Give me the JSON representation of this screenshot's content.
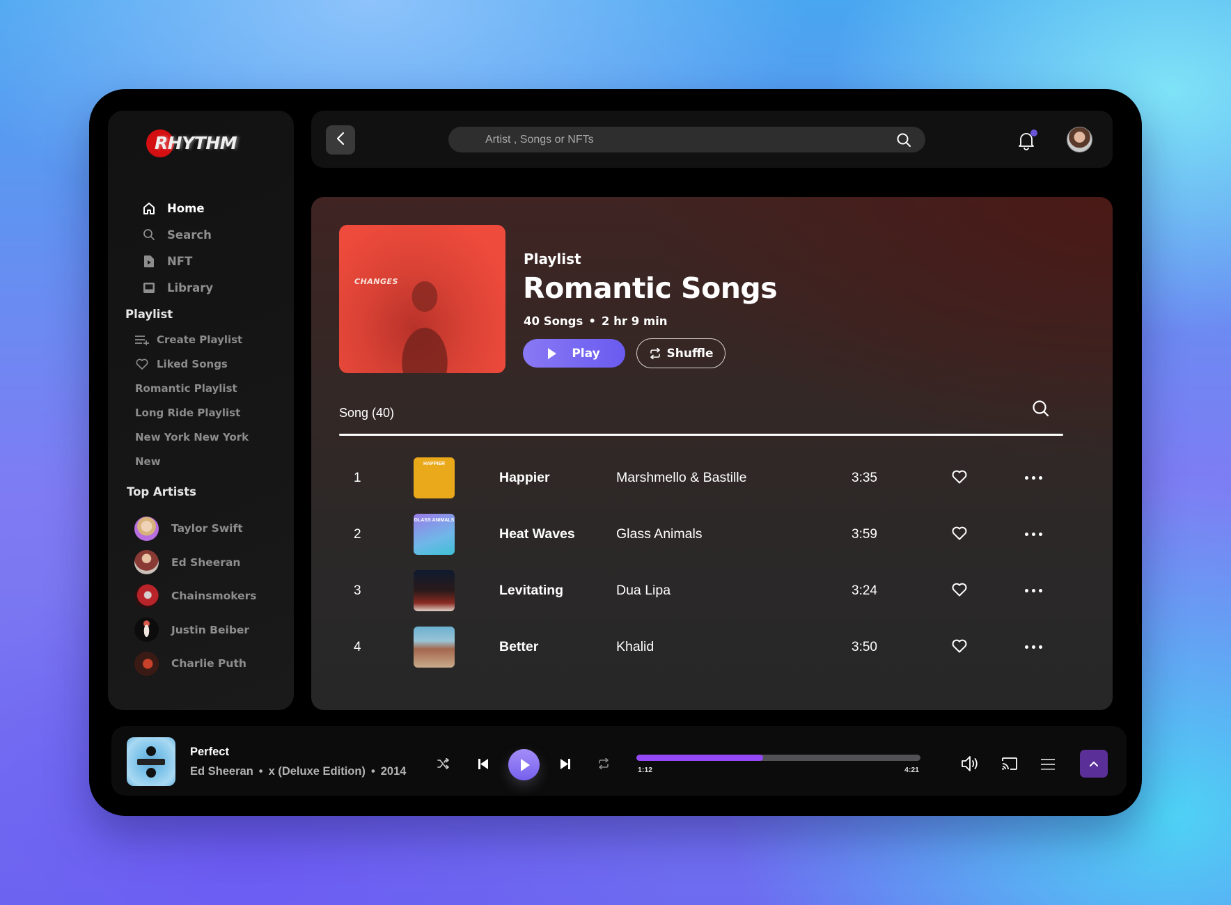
{
  "app": {
    "logo_text": "RHYTHM"
  },
  "sidebar": {
    "nav": [
      {
        "label": "Home",
        "icon": "home-icon",
        "active": true
      },
      {
        "label": "Search",
        "icon": "search-icon",
        "active": false
      },
      {
        "label": "NFT",
        "icon": "nft-file-icon",
        "active": false
      },
      {
        "label": "Library",
        "icon": "library-icon",
        "active": false
      }
    ],
    "playlist_title": "Playlist",
    "playlist_items": [
      {
        "label": "Create Playlist",
        "icon": "playlist-add-icon"
      },
      {
        "label": "Liked Songs",
        "icon": "heart-icon"
      },
      {
        "label": "Romantic Playlist"
      },
      {
        "label": "Long Ride Playlist"
      },
      {
        "label": "New York New York"
      },
      {
        "label": "New"
      }
    ],
    "artists_title": "Top Artists",
    "artists": [
      {
        "name": "Taylor Swift",
        "avatar_color": "#b86ee0"
      },
      {
        "name": "Ed Sheeran",
        "avatar_color": "#8a3a34"
      },
      {
        "name": "Chainsmokers",
        "avatar_color": "#6a1a1a"
      },
      {
        "name": "Justin Beiber",
        "avatar_color": "#101010"
      },
      {
        "name": "Charlie Puth",
        "avatar_color": "#5a1a14"
      }
    ]
  },
  "header": {
    "back_icon": "chevron-left-icon",
    "search_placeholder": "Artist , Songs or NFTs",
    "search_value": "",
    "notification_badge": true
  },
  "playlist": {
    "cover_text": "CHANGES",
    "label": "Playlist",
    "title": "Romantic Songs",
    "song_count": "40 Songs",
    "duration": "2 hr 9 min",
    "play_label": "Play",
    "shuffle_label": "Shuffle",
    "table_label": "Song (40)"
  },
  "songs": [
    {
      "num": "1",
      "title": "Happier",
      "artist": "Marshmello & Bastille",
      "duration": "3:35",
      "art_text": "HAPPIER"
    },
    {
      "num": "2",
      "title": "Heat Waves",
      "artist": "Glass Animals",
      "duration": "3:59",
      "art_text": "GLASS ANIMALS"
    },
    {
      "num": "3",
      "title": "Levitating",
      "artist": "Dua Lipa",
      "duration": "3:24",
      "art_text": ""
    },
    {
      "num": "4",
      "title": "Better",
      "artist": "Khalid",
      "duration": "3:50",
      "art_text": ""
    }
  ],
  "player": {
    "title": "Perfect",
    "artist": "Ed Sheeran",
    "album": "x (Deluxe Edition)",
    "year": "2014",
    "current_time": "1:12",
    "total_time": "4:21",
    "progress_percent": 44.5,
    "accent": "#9448f7"
  },
  "colors": {
    "accent_purple": "#7761ee",
    "expand_button": "#5a2f98",
    "logo_red": "#d40f12"
  }
}
